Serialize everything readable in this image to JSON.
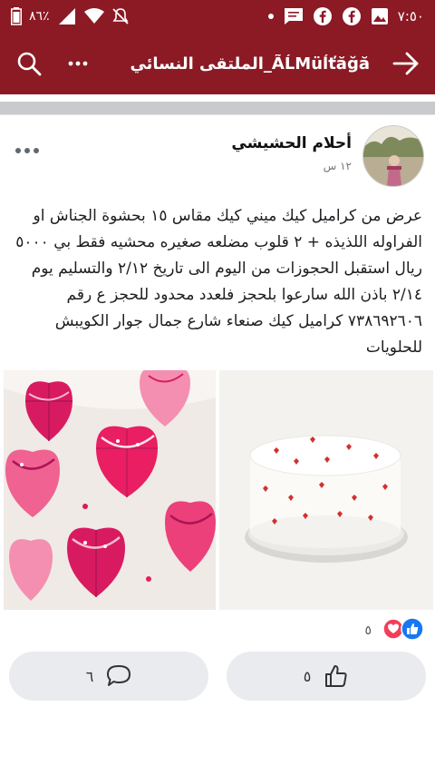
{
  "status_bar": {
    "time": "٧:٥٠",
    "battery": "٨٦٪",
    "icons": [
      "image-icon",
      "facebook-icon",
      "facebook-icon",
      "message-icon",
      "dot-icon",
      "mute-icon",
      "wifi-icon",
      "signal-icon",
      "battery-icon"
    ]
  },
  "app_bar": {
    "title": "الملتقى النسائي_ÃĹΜüĺťăğă",
    "back_icon": "arrow-icon",
    "more_icon": "more-horizontal-icon",
    "search_icon": "search-icon"
  },
  "post": {
    "author": "أحلام الحشيشي",
    "time": "١٢ س",
    "text": "عرض من كراميل كيك  ميني كيك مقاس ١٥ بحشوة الجناش  او الفراوله اللذيذه + ٢ قلوب مضلعه صغيره محشيه فقط بي ٥٠٠٠ ريال استقبل الحجوزات  من اليوم الى تاريخ ٢/١٢ والتسليم  يوم ٢/١٤ باذن الله سارعوا بلحجز فلعدد محدود  للحجز ع رقم ٧٣٨٦٩٢٦٠٦ كراميل كيك صنعاء شارع جمال جوار الكويبش للحلويات"
  },
  "reactions": {
    "count": "٥",
    "types": [
      "like-icon",
      "love-icon"
    ],
    "colors": {
      "like": "#1877f2",
      "love": "#f33e58"
    }
  },
  "actions": {
    "like_count": "٥",
    "comment_count": "٦"
  },
  "colors": {
    "brand": "#8b1a24"
  }
}
